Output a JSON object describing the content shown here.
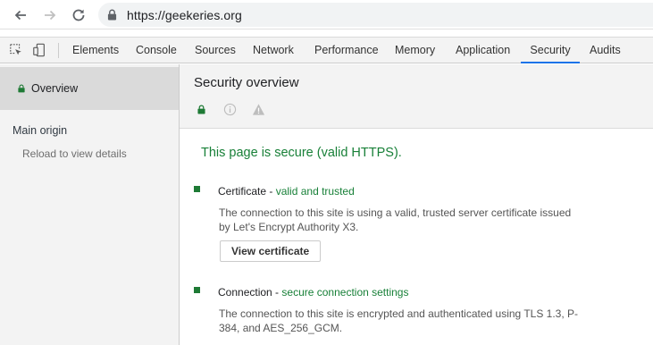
{
  "browser": {
    "url": "https://geekeries.org"
  },
  "devtools": {
    "tabs": [
      {
        "label": "Elements"
      },
      {
        "label": "Console"
      },
      {
        "label": "Sources"
      },
      {
        "label": "Network"
      },
      {
        "label": "Performance"
      },
      {
        "label": "Memory"
      },
      {
        "label": "Application"
      },
      {
        "label": "Security",
        "active": true
      },
      {
        "label": "Audits"
      }
    ],
    "accent_color": "#1a73e8"
  },
  "sidebar": {
    "overview_label": "Overview",
    "section_label": "Main origin",
    "reload_label": "Reload to view details"
  },
  "main": {
    "title": "Security overview",
    "summary": "This page is secure (valid HTTPS).",
    "secure_color": "#188038",
    "items": [
      {
        "name": "Certificate",
        "separator": " - ",
        "status": "valid and trusted",
        "description": "The connection to this site is using a valid, trusted server certificate issued by Let's Encrypt Authority X3.",
        "button_label": "View certificate"
      },
      {
        "name": "Connection",
        "separator": " - ",
        "status": "secure connection settings",
        "description": "The connection to this site is encrypted and authenticated using TLS 1.3, P-384, and AES_256_GCM."
      }
    ]
  }
}
